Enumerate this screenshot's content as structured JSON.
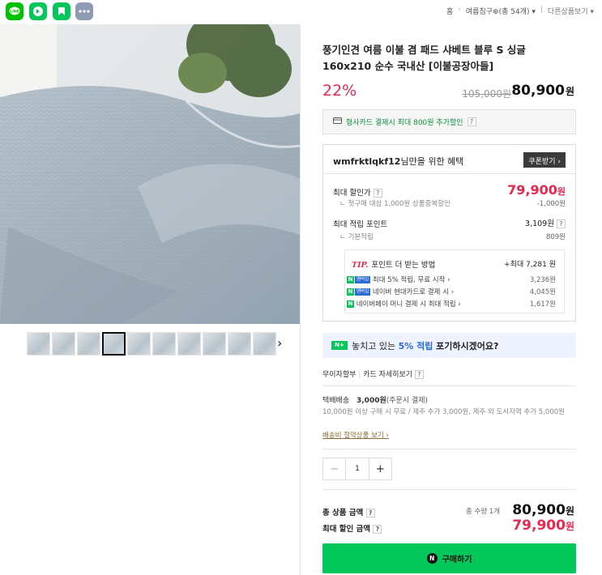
{
  "share": {
    "colors": [
      "#00c300",
      "#03c75a",
      "#03c75a",
      "#8f9bb5"
    ],
    "icons": [
      "line-icon",
      "band-icon",
      "blog-icon",
      "more-icon"
    ]
  },
  "breadcrumb": {
    "home": "홈",
    "category": "여름침구",
    "count": "(총 54개)",
    "other": "다른상품보기"
  },
  "product": {
    "title": "풍기인견 여름 이불 겸 패드 샤베트 블루 S 싱글 160x210 순수 국내산 [이불공장아들]",
    "discount_rate": "22%",
    "original_price": "105,000원",
    "sale_price": "80,900",
    "unit": "원"
  },
  "card_benefit": {
    "text": "형사카드 결제시 최대 800원 추가할인",
    "help": "?"
  },
  "benefit": {
    "user_id": "wmfrktlqkf12",
    "suffix": "님만을 위한 혜택",
    "coupon_label": "쿠폰받기 ›",
    "max_discount_label": "최대 할인가",
    "max_discount_price": "79,900",
    "max_discount_unit": "원",
    "first_purchase": "첫구매 대상 1,000원 상품중복할인",
    "first_purchase_value": "-1,000원",
    "max_point_label": "최대 적립 포인트",
    "max_point_value": "3,109원",
    "basic_point_label": "기본적립",
    "basic_point_value": "809원",
    "help": "?"
  },
  "tip": {
    "tag": "TIP.",
    "title": "포인트 더 받는 방법",
    "max": "+최대 7,281 원",
    "rows": [
      {
        "text": "최대 5% 적립, 무료 시작 ›",
        "value": "3,236원"
      },
      {
        "text": "네이버 현대카드로 결제 시 ›",
        "value": "4,045원"
      },
      {
        "text": "네이버페이 머니 결제 시 최대 적립 ›",
        "value": "1,617원"
      }
    ],
    "badge_n": "N",
    "badge_plus": "멤버십"
  },
  "banner": {
    "badge": "N+",
    "text_before": "놓치고 있는 ",
    "highlight": "5% 적립",
    "text_after": " 포기하시겠어요?"
  },
  "installment": {
    "label": "무이자할부",
    "card": "카드 자세히보기",
    "help": "?"
  },
  "shipping": {
    "label": "택배배송",
    "fee": "3,000원",
    "when": "(주문시 결제)",
    "note": "10,000원 이상 구매 시 무료 / 제주 추가 3,000원, 제주 외 도서지역 추가 5,000원",
    "link": "배송비 절약상품 보기 ›"
  },
  "quantity": {
    "minus": "−",
    "value": "1",
    "plus": "+"
  },
  "totals": {
    "total_label": "총 상품 금액",
    "count_label": "총 수량 1개",
    "total_price": "80,900",
    "max_discount_label": "최대 할인 금액",
    "max_discount_price": "79,900",
    "unit": "원",
    "help": "?"
  },
  "buy": {
    "badge": "N",
    "label": "구매하기"
  },
  "thumbnails": {
    "next": "›"
  }
}
